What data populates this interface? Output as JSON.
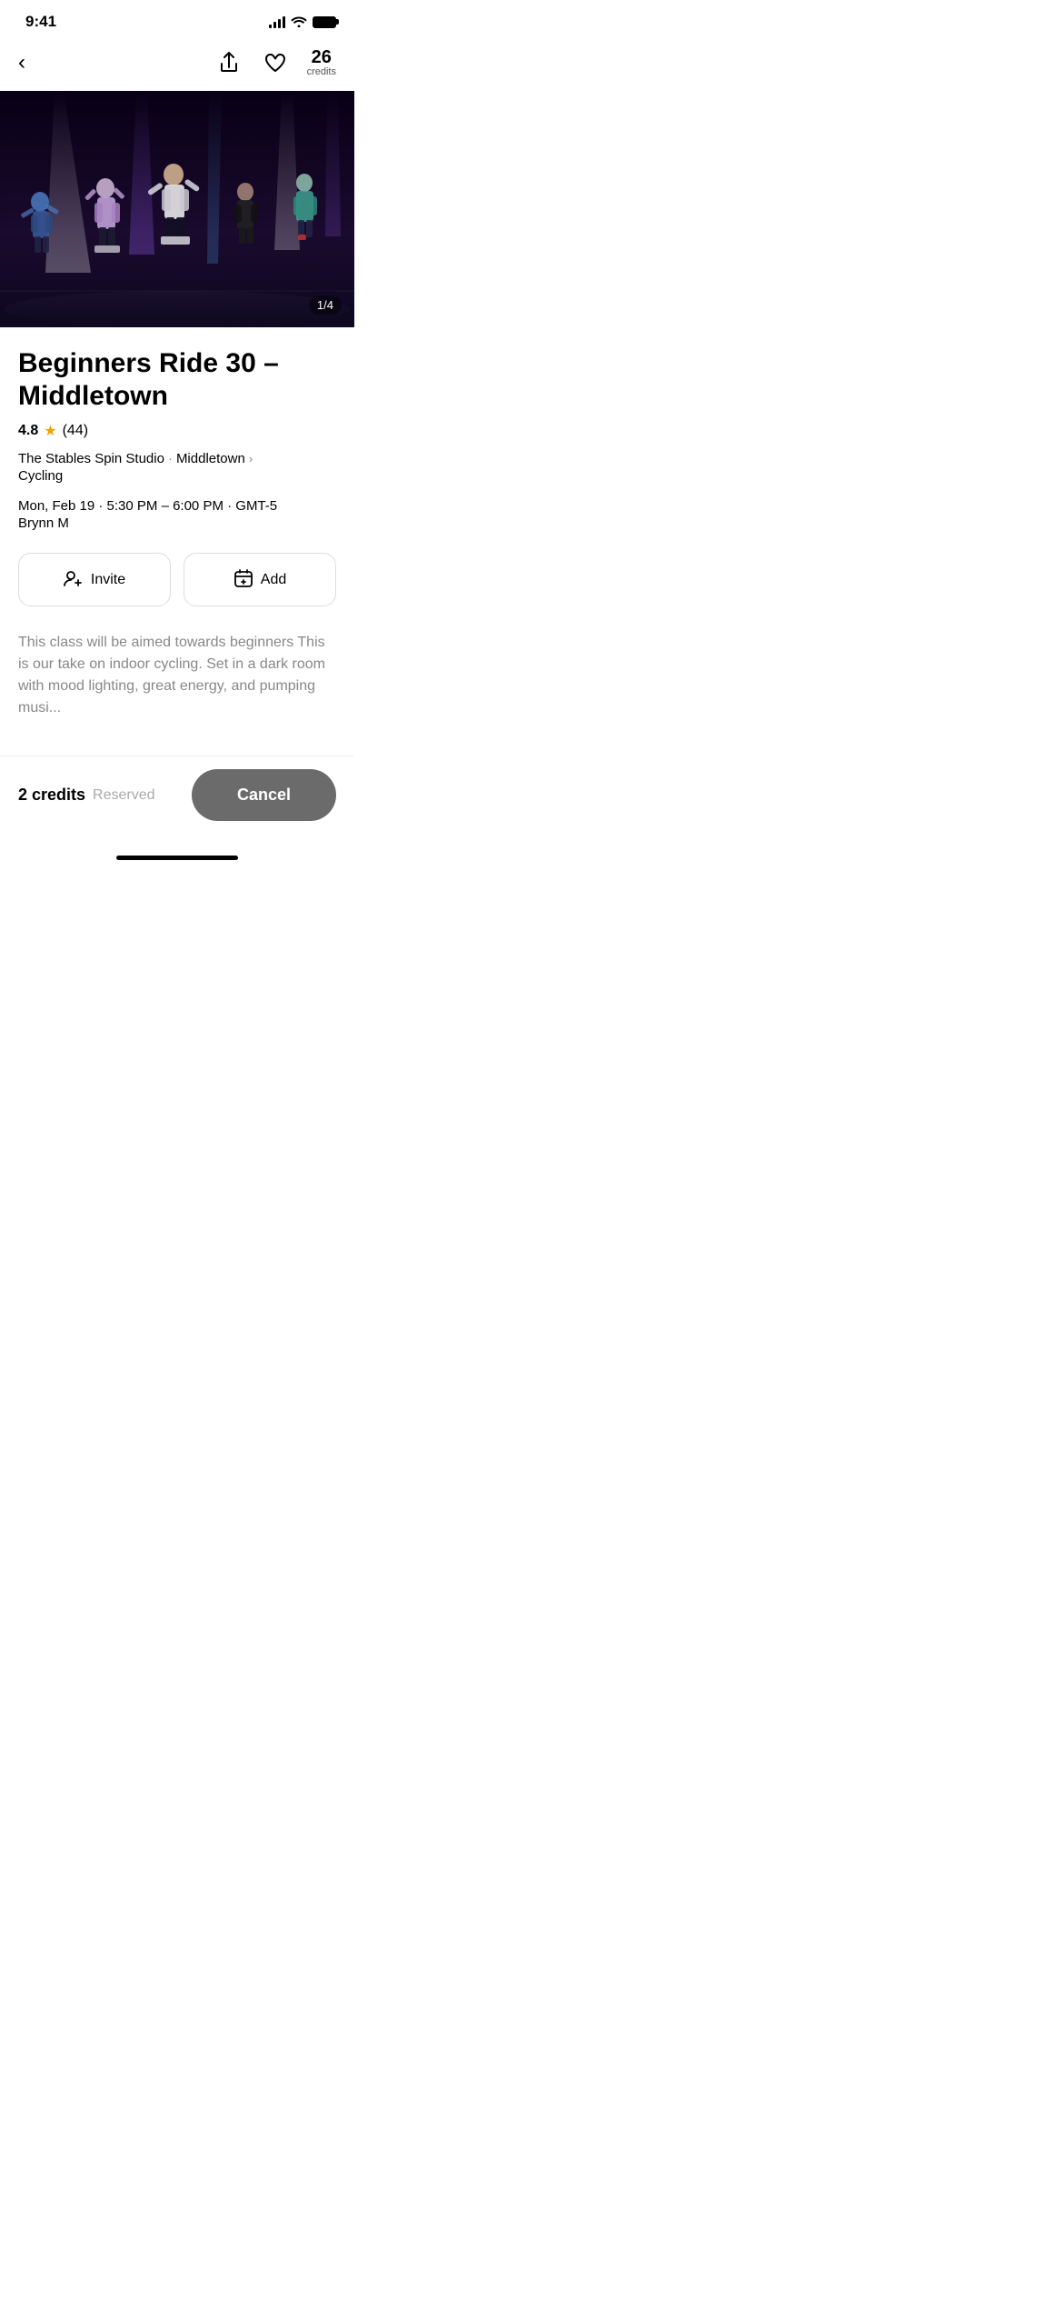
{
  "status": {
    "time": "9:41",
    "signal_bars": [
      4,
      7,
      10,
      13
    ],
    "battery_full": true
  },
  "nav": {
    "back_label": "‹",
    "credits_number": "26",
    "credits_label": "credits"
  },
  "hero": {
    "image_counter": "1/4"
  },
  "class": {
    "title": "Beginners Ride 30 – Middletown",
    "rating": "4.8",
    "rating_count": "(44)",
    "studio": "The Stables Spin Studio",
    "location": "Middletown",
    "type": "Cycling",
    "schedule": "Mon, Feb 19 · 5:30 PM – 6:00 PM · GMT-5",
    "instructor": "Brynn M",
    "invite_label": "Invite",
    "add_label": "Add",
    "description": "This class will be aimed towards beginners This is our take on indoor cycling. Set in a dark room with mood lighting, great energy, and pumping musi..."
  },
  "bottom": {
    "credits_amount": "2 credits",
    "reserved_label": "Reserved",
    "cancel_label": "Cancel"
  }
}
